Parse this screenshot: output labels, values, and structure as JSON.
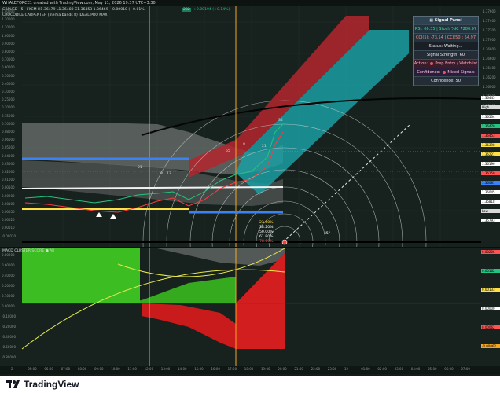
{
  "header": {
    "caption": "WHALEFORCE1 created with TradingView.com, May 11, 2026 19:37 UTC+3:30"
  },
  "legend": {
    "symbol_line": "GBPUSD · 5 · FXCM  H1.36479  L1.36480  C1.36453  1.36469  −0.00010 (−0.01%)",
    "volume_badge": "282",
    "change_badge": "+0.00194 (+0.14%)",
    "indicator_line": "CROCODILE CARPENTER (inertia bands 8)  IDEAL PRO MAX",
    "sub_indicator": "MACD CLUSTER SCORE  ● All"
  },
  "signal_panel": {
    "title": "Signal Panel",
    "rsi_row": "RSI: 66.35 | Stoch %K: 7280.97",
    "cci_row": "CCI(5): -73.54 | CCI(50): 54.97",
    "status_row": "Status: Waiting...",
    "strength_row": "Signal Strength: 60",
    "action_label": "Action:",
    "action_value": "Prep Entry / Watchlist",
    "confidence_label": "Confidence:",
    "confidence_value": "Mixed Signals",
    "confidence_score": "Confidence: 50"
  },
  "price_axis_left": [
    "1.40000",
    "1.20000",
    "1.10000",
    "1.00000",
    "0.90000",
    "0.80000",
    "0.70000",
    "0.60000",
    "0.50000",
    "0.40000",
    "0.30000",
    "0.25000",
    "0.20000",
    "0.15000",
    "0.10000",
    "0.08000",
    "0.06000",
    "0.05000",
    "0.04000",
    "0.03000",
    "0.02000",
    "0.01000",
    "0.00500",
    "0.00200",
    "0.00100",
    "0.00050",
    "0.00020",
    "0.00010",
    "-0.00010"
  ],
  "price_axis_right": [
    "1.37600",
    "1.37400",
    "1.37200",
    "1.37000",
    "1.36800",
    "1.36600",
    "1.36400",
    "1.36200",
    "1.36000",
    "1.35800",
    "1.35600"
  ],
  "price_tags": [
    {
      "label": "1.36445",
      "color": "#ffffff"
    },
    {
      "label": "High",
      "color": "#d9d9d9"
    },
    {
      "label": "1.36534",
      "color": "#ffffff"
    },
    {
      "label": "1.36470",
      "color": "#26c281"
    },
    {
      "label": "1.36453",
      "color": "#ff5252"
    },
    {
      "label": "1.36398",
      "color": "#fde047"
    },
    {
      "label": "1.36221",
      "color": "#fde047"
    },
    {
      "label": "1.36196",
      "color": "#ffffff"
    },
    {
      "label": "1.36150",
      "color": "#ff5252"
    },
    {
      "label": "1.36081",
      "color": "#3b82f6"
    },
    {
      "label": "1.36045",
      "color": "#ffffff"
    },
    {
      "label": "1.35818",
      "color": "#ffffff"
    },
    {
      "label": "Low",
      "color": "#d9d9d9"
    },
    {
      "label": "1.35793",
      "color": "#ffffff"
    }
  ],
  "ind_axis_left": [
    "0.80000",
    "0.60000",
    "0.40000",
    "0.20000",
    "0.10000",
    "0.00000",
    "-0.10000",
    "-0.20000",
    "-0.40000",
    "-0.60000",
    "-0.80000"
  ],
  "ind_tags": [
    {
      "label": "0.00206",
      "color": "#ff5252"
    },
    {
      "label": "0.00162",
      "color": "#26c281"
    },
    {
      "label": "0.00133",
      "color": "#fde047"
    },
    {
      "label": "0.00000",
      "color": "#ffffff"
    },
    {
      "label": "0.00062",
      "color": "#ff5252"
    },
    {
      "label": "-0.00062",
      "color": "#f5a623"
    }
  ],
  "time_axis": [
    "2",
    "05:00",
    "06:00",
    "07:00",
    "08:00",
    "09:00",
    "10:00",
    "11:00",
    "12:00",
    "13:00",
    "14:00",
    "15:00",
    "16:00",
    "17:00",
    "18:00",
    "19:00",
    "20:00",
    "21:00",
    "22:00",
    "23:00",
    "12",
    "01:00",
    "02:00",
    "03:00",
    "04:00",
    "05:00",
    "06:00",
    "07:00"
  ],
  "chart_labels": {
    "wave_marks": [
      "21",
      "8",
      "13",
      "8",
      "21",
      "55",
      "34",
      "8",
      "21",
      "34"
    ],
    "fib_labels": [
      "23.60%",
      "38.20%",
      "50.00%",
      "61.80%",
      "78.60%"
    ],
    "angle_label": "45°"
  },
  "footer": {
    "brand": "TradingView"
  },
  "colors": {
    "bg": "#131c19",
    "bull": "#26c281",
    "bear": "#ff3b3b",
    "teal_band": "#1a9ea3",
    "red_band": "#b3262e",
    "yellow": "#fde047",
    "blue": "#3b82f6",
    "orange_line": "#f5a623"
  }
}
